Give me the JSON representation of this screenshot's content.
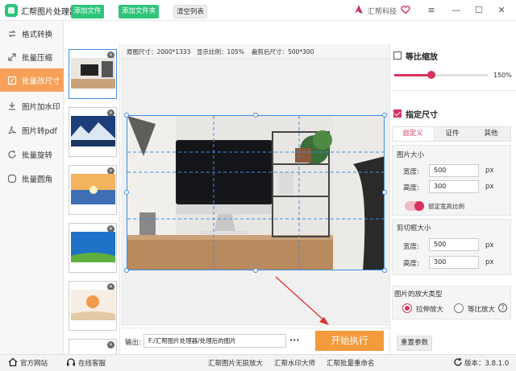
{
  "app": {
    "title": "汇帮图片处理器",
    "brand": "汇帮科技"
  },
  "sidebar": {
    "items": [
      {
        "label": "格式转换",
        "icon": "swap-icon",
        "active": false
      },
      {
        "label": "批量压缩",
        "icon": "compress-icon",
        "active": false
      },
      {
        "label": "批量改尺寸",
        "icon": "resize-icon",
        "active": true
      },
      {
        "label": "图片加水印",
        "icon": "watermark-icon",
        "active": false
      },
      {
        "label": "图片转pdf",
        "icon": "pdf-icon",
        "active": false
      },
      {
        "label": "批量旋转",
        "icon": "rotate-icon",
        "active": false
      },
      {
        "label": "批量圆角",
        "icon": "round-corner-icon",
        "active": false
      }
    ]
  },
  "toolbar": {
    "add_file": "添加文件",
    "add_folder": "添加文件夹",
    "clear_list": "清空列表"
  },
  "info": {
    "original_size": "原图尺寸：2000*1333",
    "display_ratio": "显示比例：105%",
    "cropped_size": "裁剪后尺寸：500*300"
  },
  "output": {
    "label": "输出:",
    "path": "F:/汇帮图片处理器/处理后的图片",
    "more": "···",
    "start": "开始执行"
  },
  "options": {
    "proportional": {
      "label": "等比缩放",
      "checked": false,
      "scale_value": "150%",
      "scale_fraction": 0.4
    },
    "custom": {
      "label": "指定尺寸",
      "checked": true
    },
    "tabs": [
      {
        "label": "自定义",
        "active": true
      },
      {
        "label": "证件",
        "active": false
      },
      {
        "label": "其他",
        "active": false
      }
    ],
    "image_size": {
      "title": "图片大小",
      "width_label": "宽度:",
      "width_value": "500",
      "height_label": "高度:",
      "height_value": "300",
      "unit": "px",
      "lock_label": "锁定宽高比例",
      "lock_on": true
    },
    "crop_size": {
      "title": "剪切框大小",
      "width_label": "宽度:",
      "width_value": "500",
      "height_label": "高度:",
      "height_value": "300",
      "unit": "px"
    },
    "enlarge": {
      "title": "图片的放大类型",
      "stretch": "拉伸放大",
      "proportional": "等比放大",
      "selected": "stretch"
    },
    "reset": "重置参数"
  },
  "footer": {
    "website": "官方网站",
    "support": "在线客服",
    "link1": "汇帮图片无损放大",
    "link2": "汇帮水印大师",
    "link3": "汇帮批量重命名",
    "version": "版本：3.8.1.0"
  }
}
